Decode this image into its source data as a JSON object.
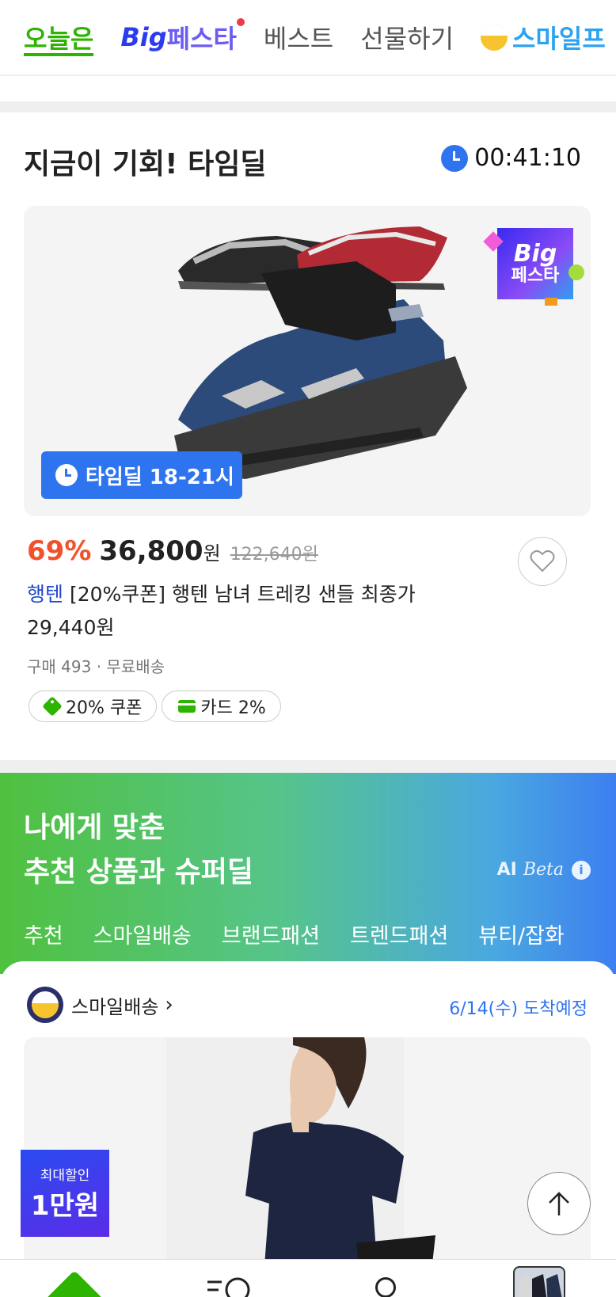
{
  "top_tabs": {
    "today": "오늘은",
    "bigfesta_a": "Big",
    "bigfesta_b": "페스타",
    "best": "베스트",
    "gift": "선물하기",
    "smile": "스마일프"
  },
  "timedeal": {
    "title": "지금이 기회! 타임딜",
    "timer": "00:41:10",
    "badge": "타임딜 18-21시",
    "bigfesta_badge_l1": "Big",
    "bigfesta_badge_l2": "페스타",
    "discount": "69%",
    "price": "36,800",
    "won": "원",
    "original_price": "122,640원",
    "brand": "행텐",
    "product_title": "[20%쿠폰] 행텐 남녀 트레킹 샌들 최종가 29,440원",
    "meta": "구매 493 · 무료배송",
    "chips": {
      "coupon": "20% 쿠폰",
      "card": "카드 2%"
    }
  },
  "ai_section": {
    "title_line1": "나에게 맞춘",
    "title_line2": "추천 상품과 슈퍼딜",
    "ai_label": "AI",
    "beta_label": "Beta",
    "tabs": [
      "추천",
      "스마일배송",
      "브랜드패션",
      "트렌드패션",
      "뷰티/잡화"
    ]
  },
  "smile_delivery": {
    "label": "스마일배송",
    "arrival": "6/14(수) 도착예정"
  },
  "max_discount": {
    "line1": "최대할인",
    "line2": "1만원"
  },
  "colors": {
    "green": "#2db400",
    "blue": "#2f74ef",
    "discount_red": "#f0532b"
  }
}
